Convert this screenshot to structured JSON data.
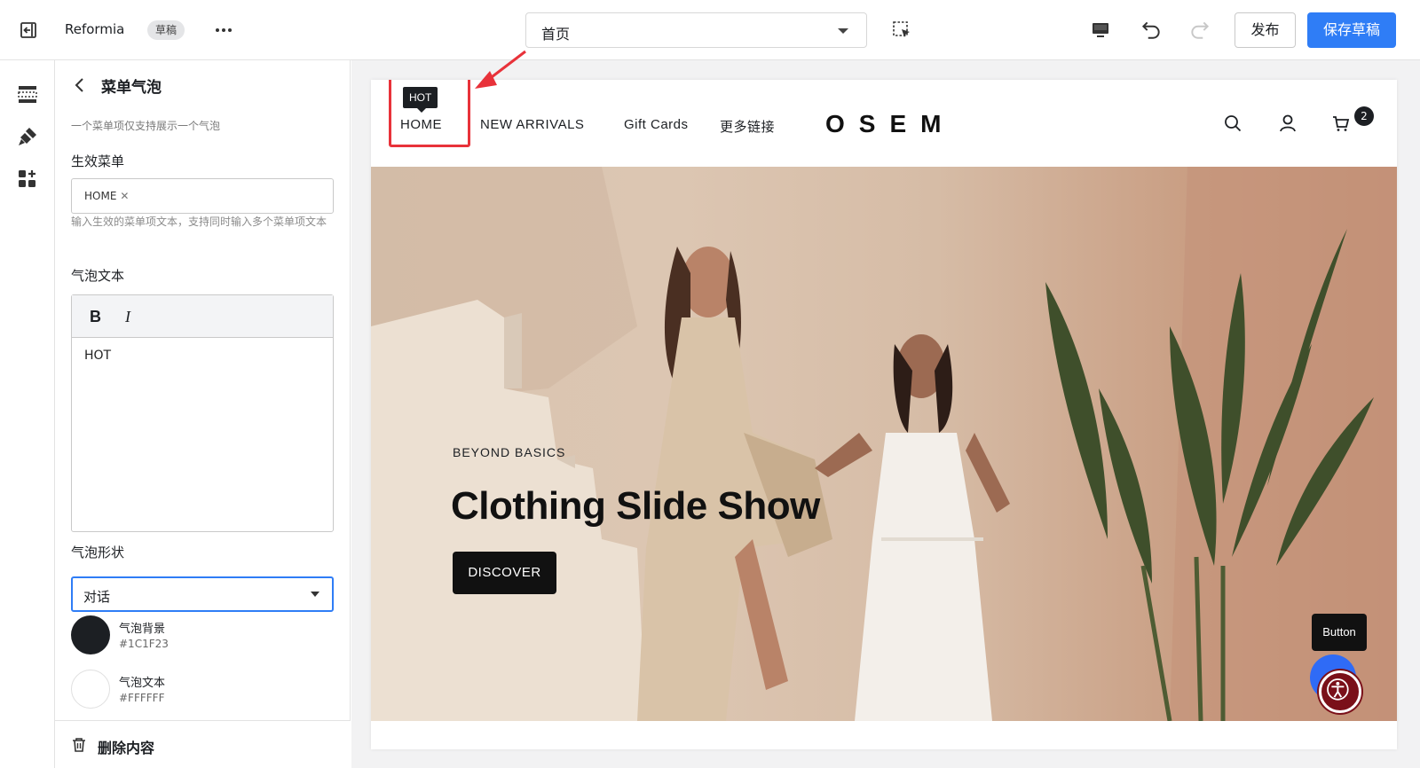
{
  "topbar": {
    "app_name": "Reformia",
    "draft_badge": "草稿",
    "page_selector": "首页",
    "publish_label": "发布",
    "save_label": "保存草稿"
  },
  "panel": {
    "title": "菜单气泡",
    "description": "一个菜单项仅支持展示一个气泡",
    "active_menu_label": "生效菜单",
    "active_menu_tags": [
      "HOME"
    ],
    "active_menu_hint": "输入生效的菜单项文本，支持同时输入多个菜单项文本",
    "bubble_text_label": "气泡文本",
    "editor_bold": "B",
    "editor_italic": "I",
    "bubble_text_value": "HOT",
    "bubble_shape_label": "气泡形状",
    "bubble_shape_value": "对话",
    "bg_color_label": "气泡背景",
    "bg_color_value": "#1C1F23",
    "text_color_label": "气泡文本",
    "text_color_value": "#FFFFFF",
    "delete_label": "删除内容"
  },
  "preview": {
    "bubble": "HOT",
    "nav": [
      "HOME",
      "NEW ARRIVALS",
      "Gift Cards",
      "更多链接"
    ],
    "logo": "OSEM",
    "cart_count": "2",
    "hero_overline": "BEYOND BASICS",
    "hero_title": "Clothing Slide Show",
    "hero_cta": "DISCOVER",
    "floating_button": "Button"
  },
  "colors": {
    "accent": "#2f7df6",
    "bubble_bg": "#1C1F23",
    "bubble_text": "#FFFFFF",
    "highlight": "#e8323a"
  }
}
